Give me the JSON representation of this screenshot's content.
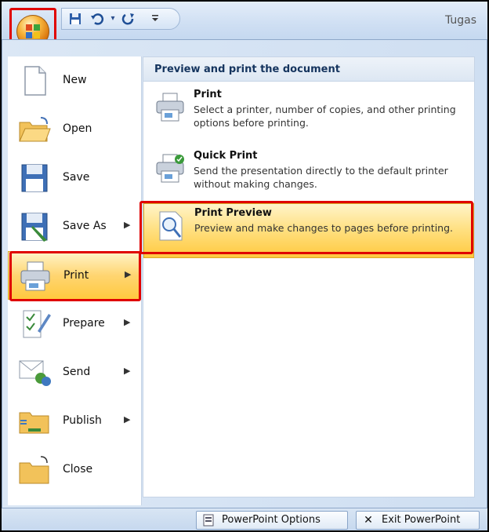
{
  "title_bar": {
    "title_fragment": "Tugas"
  },
  "qat": {
    "save_icon": "save-icon",
    "undo_icon": "undo-icon",
    "redo_icon": "redo-icon",
    "customize_icon": "customize-qat-icon"
  },
  "left_menu": {
    "items": [
      {
        "label": "New",
        "underline": "N",
        "icon": "new-document-icon",
        "has_submenu": false
      },
      {
        "label": "Open",
        "underline": "O",
        "icon": "open-folder-icon",
        "has_submenu": false
      },
      {
        "label": "Save",
        "underline": "S",
        "icon": "save-disk-icon",
        "has_submenu": false
      },
      {
        "label": "Save As",
        "underline": "A",
        "icon": "save-as-icon",
        "has_submenu": true
      },
      {
        "label": "Print",
        "underline": "P",
        "icon": "printer-icon",
        "has_submenu": true
      },
      {
        "label": "Prepare",
        "underline": "e",
        "icon": "prepare-icon",
        "has_submenu": true
      },
      {
        "label": "Send",
        "underline": "d",
        "icon": "send-icon",
        "has_submenu": true
      },
      {
        "label": "Publish",
        "underline": "u",
        "icon": "publish-icon",
        "has_submenu": true
      },
      {
        "label": "Close",
        "underline": "C",
        "icon": "close-folder-icon",
        "has_submenu": false
      }
    ]
  },
  "right_panel": {
    "header": "Preview and print the document",
    "options": [
      {
        "title": "Print",
        "underline": "P",
        "description": "Select a printer, number of copies, and other printing options before printing.",
        "icon": "printer-icon"
      },
      {
        "title": "Quick Print",
        "underline": "Q",
        "description": "Send the presentation directly to the default printer without making changes.",
        "icon": "quick-print-icon"
      },
      {
        "title": "Print Preview",
        "underline": "v",
        "description": "Preview and make changes to pages before printing.",
        "icon": "print-preview-icon"
      }
    ]
  },
  "bottom_buttons": {
    "options_label": "PowerPoint Options",
    "exit_label": "Exit PowerPoint"
  },
  "colors": {
    "highlight": "#ffd571",
    "annotation_red": "#e00000",
    "header_text": "#15345e"
  }
}
